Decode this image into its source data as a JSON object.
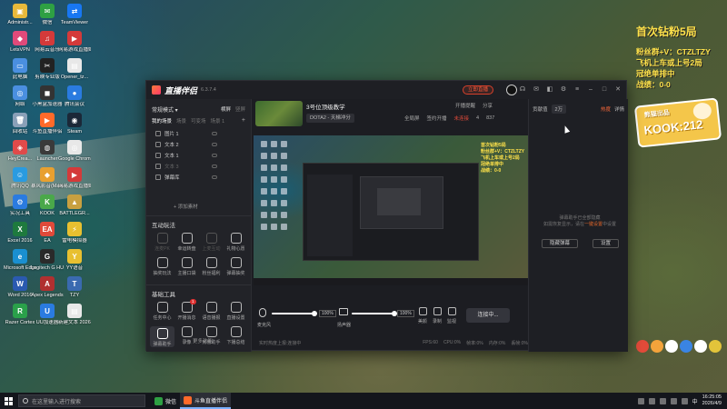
{
  "desktop": {
    "icons": [
      {
        "label": "Administr...",
        "color": "#e8b93a",
        "glyph": "▣"
      },
      {
        "label": "微信",
        "color": "#2ea043",
        "glyph": "✉"
      },
      {
        "label": "TeamViewer",
        "color": "#1877f2",
        "glyph": "⇄"
      },
      {
        "label": "LetsVPN",
        "color": "#e04a7a",
        "glyph": "◆"
      },
      {
        "label": "网易云音乐",
        "color": "#d43a3a",
        "glyph": "♫"
      },
      {
        "label": "网易游戏直播姬",
        "color": "#d43a3a",
        "glyph": "▶"
      },
      {
        "label": "此电脑",
        "color": "#4a8fe0",
        "glyph": "▭"
      },
      {
        "label": "剪映专业版",
        "color": "#222222",
        "glyph": "✂"
      },
      {
        "label": "Opener_tz...",
        "color": "#e8e8e8",
        "glyph": "▤"
      },
      {
        "label": "网络",
        "color": "#4a8fe0",
        "glyph": "◎"
      },
      {
        "label": "小黑盒加速器",
        "color": "#333333",
        "glyph": "◼"
      },
      {
        "label": "腾讯会议",
        "color": "#2a7be0",
        "glyph": "●"
      },
      {
        "label": "回收站",
        "color": "#8aa0b8",
        "glyph": "🗑"
      },
      {
        "label": "斗鱼直播伴侣",
        "color": "#ff6a2a",
        "glyph": "▶"
      },
      {
        "label": "Steam",
        "color": "#1b2838",
        "glyph": "◉"
      },
      {
        "label": "HeyCrea...",
        "color": "#e04a4a",
        "glyph": "◈"
      },
      {
        "label": "Launcher",
        "color": "#3a3a3a",
        "glyph": "◍"
      },
      {
        "label": "Google Chrome",
        "color": "#e8e8e8",
        "glyph": "◎"
      },
      {
        "label": "腾讯QQ",
        "color": "#2a9be0",
        "glyph": "☺"
      },
      {
        "label": "暴风影音(Marsvip)",
        "color": "#e8a030",
        "glyph": "◆"
      },
      {
        "label": "网易游戏直播姬",
        "color": "#d43a3a",
        "glyph": "▶"
      },
      {
        "label": "实况工具",
        "color": "#2a7be0",
        "glyph": "⚙"
      },
      {
        "label": "KOOK",
        "color": "#4aa84a",
        "glyph": "K"
      },
      {
        "label": "BATTLEGR...",
        "color": "#c8a040",
        "glyph": "▲"
      },
      {
        "label": "Excel 2016",
        "color": "#1e7a3e",
        "glyph": "X"
      },
      {
        "label": "EA",
        "color": "#e04a3a",
        "glyph": "EA"
      },
      {
        "label": "雷电模拟器",
        "color": "#e8c030",
        "glyph": "⚡"
      },
      {
        "label": "Microsoft Edge",
        "color": "#1a8fd0",
        "glyph": "e"
      },
      {
        "label": "Logitech G HUB",
        "color": "#2a2a2a",
        "glyph": "G"
      },
      {
        "label": "YY语音",
        "color": "#e8c030",
        "glyph": "Y"
      },
      {
        "label": "Word 2016",
        "color": "#2a5ab0",
        "glyph": "W"
      },
      {
        "label": "Apex Legends",
        "color": "#b03030",
        "glyph": "A"
      },
      {
        "label": "TZY",
        "color": "#3a6ab0",
        "glyph": "T"
      },
      {
        "label": "Razer Cortex",
        "color": "#2aa04a",
        "glyph": "R"
      },
      {
        "label": "UU加速器",
        "color": "#2a7be0",
        "glyph": "U"
      },
      {
        "label": "新建文本 20260311",
        "color": "#e8e8e8",
        "glyph": "▤"
      }
    ]
  },
  "overlay": {
    "title": "首次钻粉5局",
    "lines": [
      "粉丝群+V：CTZLTZY",
      "飞机上车或上号2局",
      "冠绝单排中",
      "战绩：0-0"
    ],
    "logo_top": "熊猫出品",
    "logo_main": "KOOK:212"
  },
  "app": {
    "name": "直播伴侣",
    "version": "6.3.7.4",
    "open_live": "立即直播",
    "window_controls": [
      "客服",
      "消息",
      "皮肤",
      "设置",
      "菜单",
      "最小化",
      "最大化",
      "关闭"
    ],
    "mode": "常规模式 ▾",
    "mode_actions": [
      "横屏",
      "竖屏"
    ],
    "scene_tabs": [
      "我的场景",
      "场景",
      "可变场",
      "场景 1",
      "+"
    ],
    "sources": [
      {
        "label": "图片 1",
        "dim": false
      },
      {
        "label": "文本 2",
        "dim": false
      },
      {
        "label": "文本 1",
        "dim": false
      },
      {
        "label": "文本 3",
        "dim": true
      },
      {
        "label": "弹幕库",
        "dim": false
      }
    ],
    "add_material": "+ 添加素材",
    "sections": {
      "interactive": "互动玩法",
      "basic": "基础工具"
    },
    "interactive_tools": [
      {
        "label": "连麦PK",
        "dim": true
      },
      {
        "label": "幸运转盘",
        "dim": false
      },
      {
        "label": "上麦互动",
        "dim": true
      },
      {
        "label": "礼物心愿",
        "dim": false
      },
      {
        "label": "抽奖玩法",
        "dim": false
      },
      {
        "label": "主播口袋",
        "dim": false
      },
      {
        "label": "粉丝福利",
        "dim": false
      },
      {
        "label": "弹幕抽奖",
        "dim": false
      }
    ],
    "basic_tools": [
      {
        "label": "任务中心",
        "active": false,
        "badge": ""
      },
      {
        "label": "开播消息",
        "active": false,
        "badge": "1"
      },
      {
        "label": "语音播报",
        "active": false,
        "badge": ""
      },
      {
        "label": "直播设置",
        "active": false,
        "badge": ""
      },
      {
        "label": "弹幕助手",
        "active": true,
        "badge": ""
      },
      {
        "label": "录像",
        "active": false,
        "badge": ""
      },
      {
        "label": "房管助手",
        "active": false,
        "badge": ""
      },
      {
        "label": "下播总结",
        "active": false,
        "badge": ""
      }
    ],
    "more_functions": "··· 更多功能",
    "room": {
      "title": "3号位顶级教学",
      "category": "DOTA2 - 天梯冲分",
      "header_actions": [
        "开播提醒",
        "分享"
      ],
      "header_actions2": [
        "全局屏",
        "签约开播",
        "未连接"
      ],
      "likes": "4",
      "fans": "837",
      "not_connected": "未连接"
    },
    "right_panel": {
      "tabs": [
        "贡献值",
        "2万",
        "热度",
        "详情"
      ],
      "info_line1": "弹幕助手已全部隐藏",
      "info_line2_pre": "如需恢复显示，请在",
      "info_link": "一键设置",
      "info_line2_post": "中设置",
      "buttons": [
        "隐藏弹幕",
        "设置"
      ]
    },
    "preview": {
      "overlay_lines": [
        "首次钻粉5局",
        "粉丝群+V：CTZLTZY",
        "飞机上车或上号2局",
        "冠绝单排中",
        "战绩：0-0"
      ]
    },
    "audio": {
      "mic_label": "麦克风",
      "mic_pct": "100%",
      "speaker_label": "扬声器",
      "speaker_pct": "100%",
      "tools": [
        "美颜",
        "录制",
        "监视",
        "设置"
      ],
      "connect": "连接中..."
    },
    "status": {
      "left": "实时热度上报:连接中",
      "items": [
        "FPS:60",
        "CPU:0%",
        "帧率:0%",
        "内存:0%",
        "丢帧:0%"
      ]
    }
  },
  "taskbar": {
    "search_placeholder": "在这里输入进行搜索",
    "items": [
      {
        "label": "微信",
        "color": "#2ea043",
        "active": false
      },
      {
        "label": "斗鱼直播伴侣",
        "color": "#ff6a2a",
        "active": true
      }
    ],
    "ime": "中",
    "time": "16:25:05",
    "date": "2026/4/9"
  }
}
